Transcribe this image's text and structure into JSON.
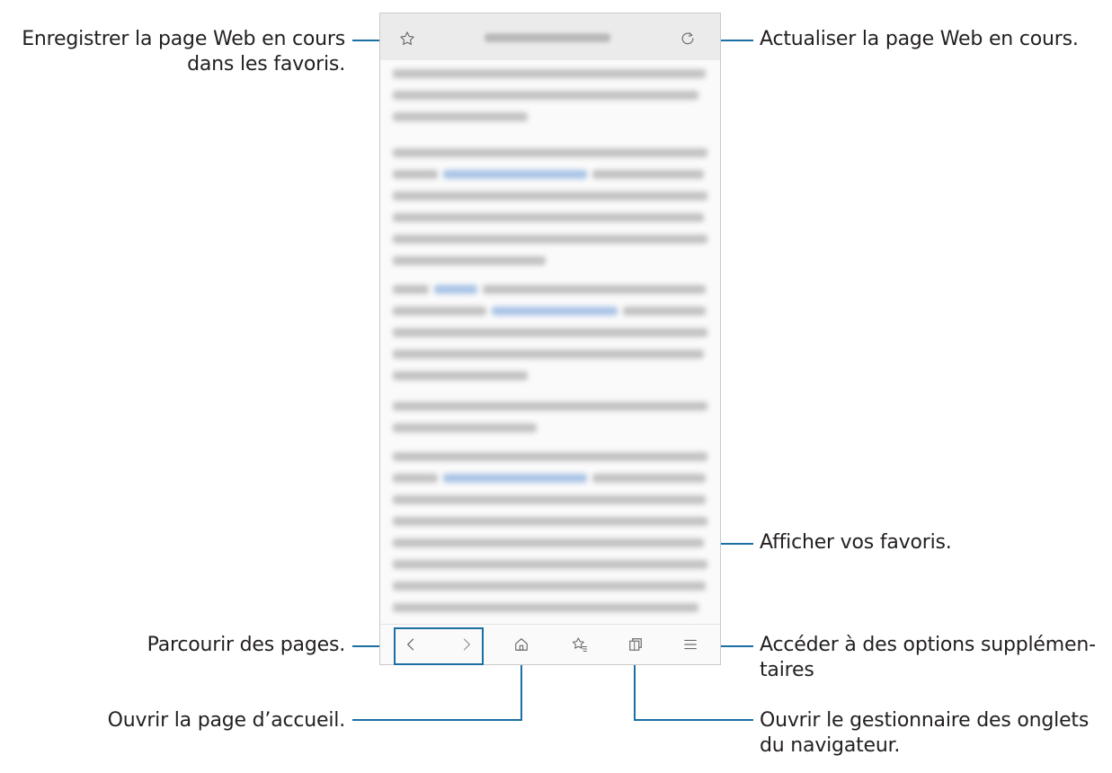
{
  "callouts": {
    "bookmark_add_line1": "Enregistrer la page Web en cours",
    "bookmark_add_line2": "dans les favoris.",
    "refresh": "Actualiser la page Web en cours.",
    "bookmarks_view": "Afficher vos favoris.",
    "navigate": "Parcourir des pages.",
    "more_options_line1": "Accéder à des options supplémen-",
    "more_options_line2": "taires",
    "home": "Ouvrir la page d’accueil.",
    "tabs_line1": "Ouvrir le gestionnaire des onglets",
    "tabs_line2": "du navigateur."
  },
  "browser": {
    "toolbar_icons": [
      "star-icon",
      "refresh-icon"
    ],
    "bottom_icons": [
      "back-icon",
      "forward-icon",
      "home-icon",
      "bookmarks-icon",
      "tabs-icon",
      "menu-icon"
    ]
  },
  "colors": {
    "leader": "#1a6fa3",
    "icon": "#6b6b6b"
  }
}
